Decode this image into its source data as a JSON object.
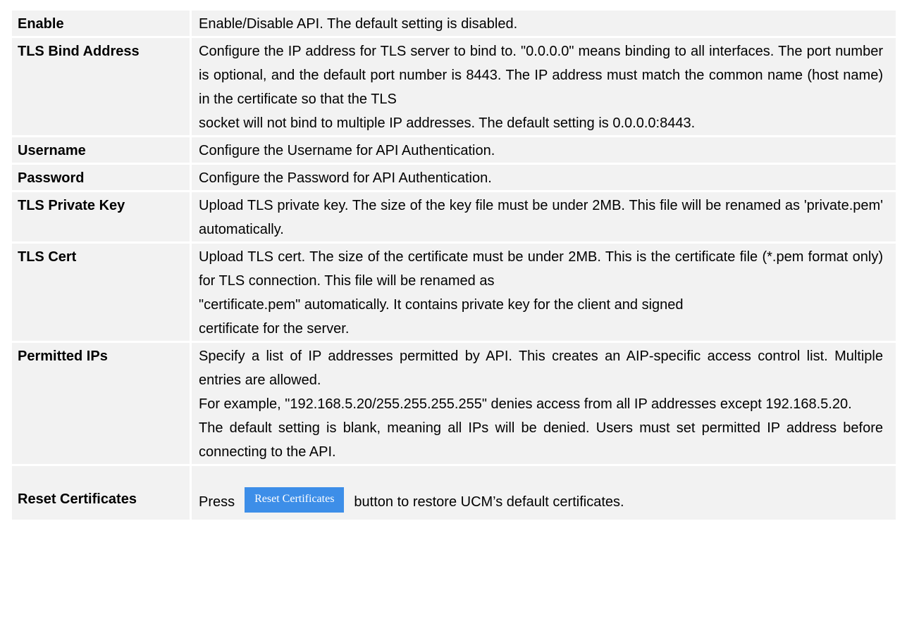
{
  "rows": [
    {
      "label": "Enable",
      "lines": [
        "Enable/Disable API. The default setting is disabled."
      ]
    },
    {
      "label": "TLS Bind Address",
      "lines": [
        "Configure the IP address for TLS server to bind to. \"0.0.0.0\" means binding to all interfaces. The port number is optional, and the default port number is 8443. The IP address must match the common name (host name) in the certificate so that the TLS",
        "socket will not bind to multiple IP addresses. The default setting is 0.0.0.0:8443."
      ]
    },
    {
      "label": "Username",
      "lines": [
        "Configure the Username for API Authentication."
      ]
    },
    {
      "label": "Password",
      "lines": [
        "Configure the Password for API Authentication."
      ]
    },
    {
      "label": "TLS Private Key",
      "lines": [
        "Upload TLS private key. The size of the key file must be under 2MB. This file will be renamed as 'private.pem' automatically."
      ]
    },
    {
      "label": "TLS Cert",
      "lines": [
        "Upload TLS cert. The size of the certificate must be under 2MB. This is the certificate file (*.pem format only) for TLS connection. This file will be renamed as",
        "\"certificate.pem\" automatically. It contains private key for the client and signed",
        "certificate for the server."
      ]
    },
    {
      "label": "Permitted IPs",
      "lines": [
        "Specify a list of IP addresses permitted by API. This creates an AIP-specific access control list. Multiple entries are allowed.",
        "For example, \"192.168.5.20/255.255.255.255\" denies access from all IP addresses except 192.168.5.20.",
        "The default setting is blank, meaning all IPs will be denied. Users must set permitted IP address before connecting to the API."
      ]
    }
  ],
  "reset": {
    "label": "Reset Certificates",
    "prefix": "Press",
    "button_label": "Reset Certificates",
    "suffix": "button to restore UCM’s default certificates."
  },
  "colors": {
    "row_background": "#f2f2f2",
    "button_background": "#3d8ee8",
    "button_text": "#ffffff"
  }
}
